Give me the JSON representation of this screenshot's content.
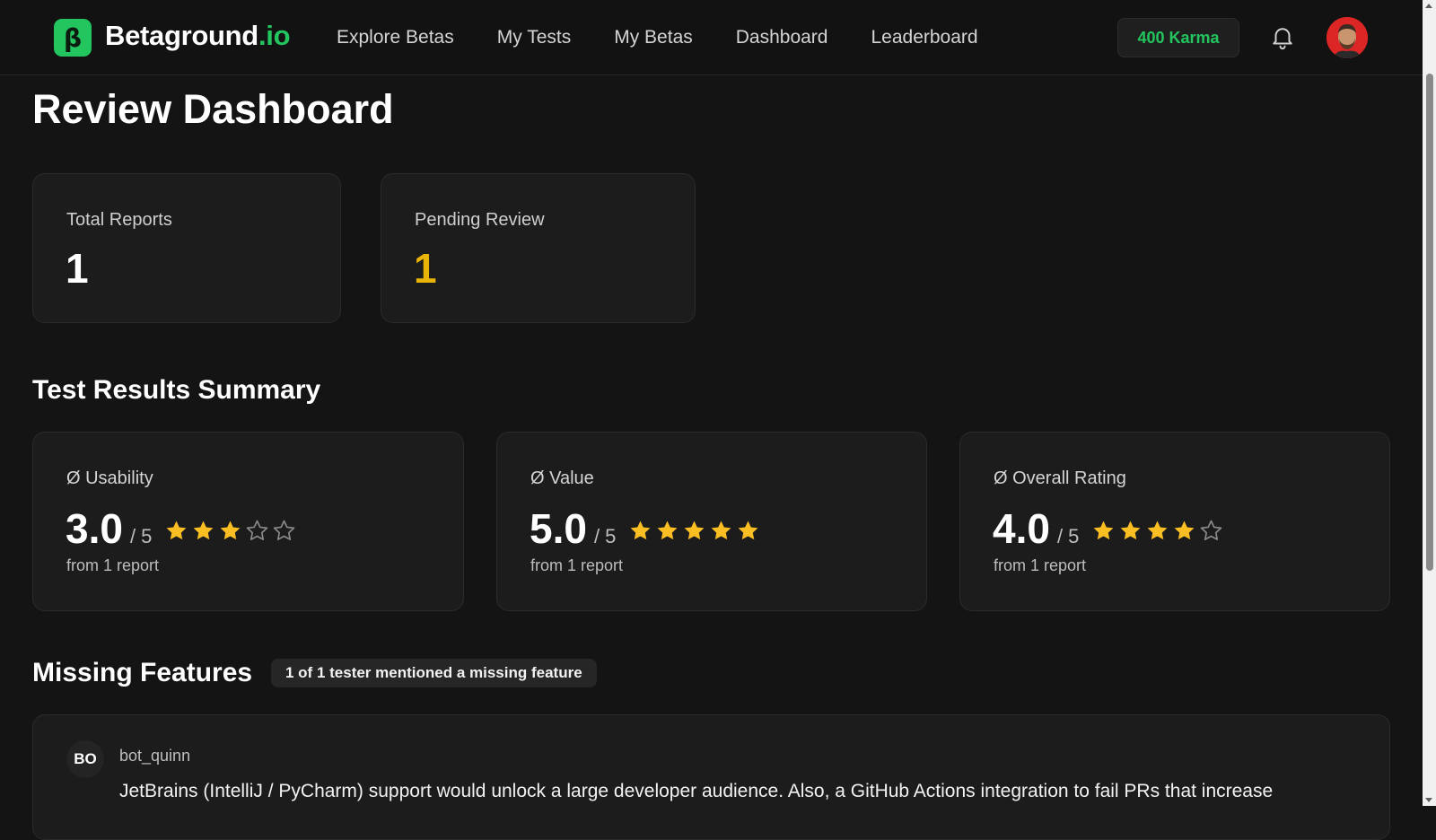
{
  "header": {
    "logo_mark": "β",
    "logo_name": "Betaground",
    "logo_tld": ".io",
    "nav": [
      "Explore Betas",
      "My Tests",
      "My Betas",
      "Dashboard",
      "Leaderboard"
    ],
    "karma": "400 Karma",
    "bell_icon": "bell-icon",
    "avatar_icon": "user-avatar"
  },
  "page": {
    "title": "Review Dashboard"
  },
  "stats": {
    "total": {
      "label": "Total Reports",
      "value": "1"
    },
    "pending": {
      "label": "Pending Review",
      "value": "1",
      "color": "#eab308"
    }
  },
  "summary": {
    "title": "Test Results Summary",
    "ratings": [
      {
        "label": "Ø Usability",
        "score": "3.0",
        "max": "/ 5",
        "stars": 3,
        "sub": "from 1 report"
      },
      {
        "label": "Ø Value",
        "score": "5.0",
        "max": "/ 5",
        "stars": 5,
        "sub": "from 1 report"
      },
      {
        "label": "Ø Overall Rating",
        "score": "4.0",
        "max": "/ 5",
        "stars": 4,
        "sub": "from 1 report"
      }
    ]
  },
  "missing": {
    "title": "Missing Features",
    "badge": "1 of 1 tester mentioned a missing feature",
    "entries": [
      {
        "initials": "BO",
        "name": "bot_quinn",
        "text": "JetBrains (IntelliJ / PyCharm) support would unlock a large developer audience. Also, a GitHub Actions integration to fail PRs that increase"
      }
    ]
  },
  "colors": {
    "accent": "#22c55e",
    "star": "#fbbf24",
    "pending": "#eab308"
  }
}
